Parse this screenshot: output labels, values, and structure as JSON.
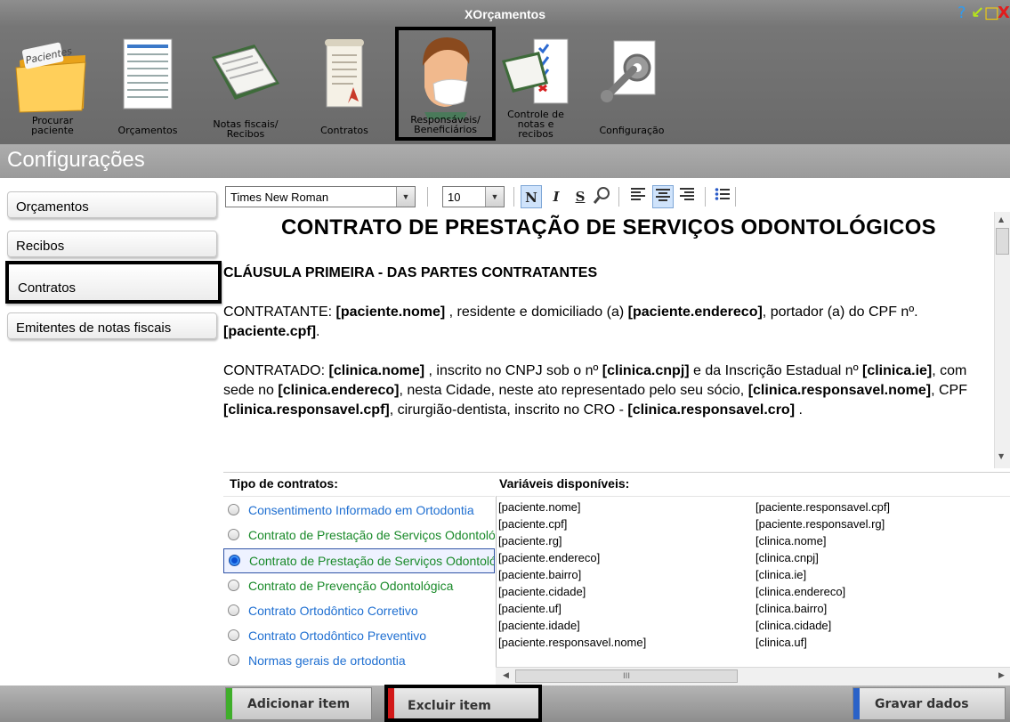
{
  "app": {
    "title": "XOrçamentos"
  },
  "window_controls": [
    "?",
    "↙",
    "□",
    "X"
  ],
  "toolbar_items": [
    {
      "label": "Procurar paciente",
      "icon": "folder-pacientes-icon",
      "badge": "Pacientes"
    },
    {
      "label": "Orçamentos",
      "icon": "document-list-icon"
    },
    {
      "label": "Notas fiscais/ Recibos",
      "icon": "notes-receipts-icon"
    },
    {
      "label": "Contratos",
      "icon": "contract-scroll-icon"
    },
    {
      "label": "Responsáveis/ Beneficiários",
      "icon": "person-mask-icon",
      "selected": true
    },
    {
      "label": "Controle de notas e recibos",
      "icon": "checklist-icon"
    },
    {
      "label": "Configuração",
      "icon": "wrench-gear-icon"
    }
  ],
  "section": {
    "title": "Configurações"
  },
  "sidebar": {
    "items": [
      {
        "label": "Orçamentos"
      },
      {
        "label": "Recibos"
      },
      {
        "label": "Contratos",
        "selected": true
      },
      {
        "label": "Emitentes de notas fiscais"
      }
    ]
  },
  "format_toolbar": {
    "font": "Times New Roman",
    "size": "10",
    "bold": "N",
    "italic": "I",
    "underline": "S"
  },
  "document": {
    "title": "CONTRATO DE PRESTAÇÃO DE SERVIÇOS ODONTOLÓGICOS",
    "clause1": "CLÁUSULA PRIMEIRA - DAS PARTES CONTRATANTES",
    "p1": {
      "label": "CONTRATANTE",
      "v_nome": "[paciente.nome]",
      "t1": " , residente e domiciliado (a) ",
      "v_endereco": "[paciente.endereco]",
      "t2": ", portador (a) do CPF nº. ",
      "v_cpf": "[paciente.cpf]",
      "t3": "."
    },
    "p2": {
      "label": "CONTRATADO",
      "v_nome": "[clinica.nome]",
      "t1": " , inscrito no CNPJ sob o nº ",
      "v_cnpj": "[clinica.cnpj]",
      "t2": "  e da Inscrição Estadual nº ",
      "v_ie": "[clinica.ie]",
      "t3": ", com sede no ",
      "v_endereco": "[clinica.endereco]",
      "t4": ", nesta Cidade, neste ato representado pelo seu sócio, ",
      "v_resp_nome": "[clinica.responsavel.nome]",
      "t5": ", CPF ",
      "v_resp_cpf": "[clinica.responsavel.cpf]",
      "t6": ", cirurgião-dentista, inscrito no CRO - ",
      "v_resp_cro": "[clinica.responsavel.cro]",
      "t7": " ."
    }
  },
  "contract_types": {
    "header": "Tipo de contratos:",
    "items": [
      {
        "label": "Consentimento Informado em Ortodontia",
        "color": "#1f6fd1"
      },
      {
        "label": "Contrato de Prestação de Serviços Odontológicos",
        "color": "#1a8a2a"
      },
      {
        "label": "Contrato de Prestação de Serviços Odontológicos",
        "color": "#1a8a2a",
        "selected": true
      },
      {
        "label": "Contrato de Prevenção Odontológica",
        "color": "#1a8a2a"
      },
      {
        "label": "Contrato Ortodôntico Corretivo",
        "color": "#1f6fd1"
      },
      {
        "label": "Contrato Ortodôntico Preventivo",
        "color": "#1f6fd1"
      },
      {
        "label": "Normas gerais de ortodontia",
        "color": "#1f6fd1"
      }
    ]
  },
  "variables": {
    "header": "Variáveis disponíveis:",
    "col1": [
      "[paciente.nome]",
      "[paciente.cpf]",
      "[paciente.rg]",
      "[paciente.endereco]",
      "[paciente.bairro]",
      "[paciente.cidade]",
      "[paciente.uf]",
      "[paciente.idade]",
      "[paciente.responsavel.nome]"
    ],
    "col2": [
      "[paciente.responsavel.cpf]",
      "[paciente.responsavel.rg]",
      "[clinica.nome]",
      "[clinica.cnpj]",
      "[clinica.ie]",
      "[clinica.endereco]",
      "[clinica.bairro]",
      "[clinica.cidade]",
      "[clinica.uf]"
    ],
    "scroll_thumb": "III"
  },
  "actions": {
    "add": "Adicionar item",
    "delete": "Excluir item",
    "save": "Gravar dados"
  },
  "colors": {
    "add_accent": "#3fae2a",
    "delete_accent": "#d21818",
    "save_accent": "#2a62c8"
  }
}
